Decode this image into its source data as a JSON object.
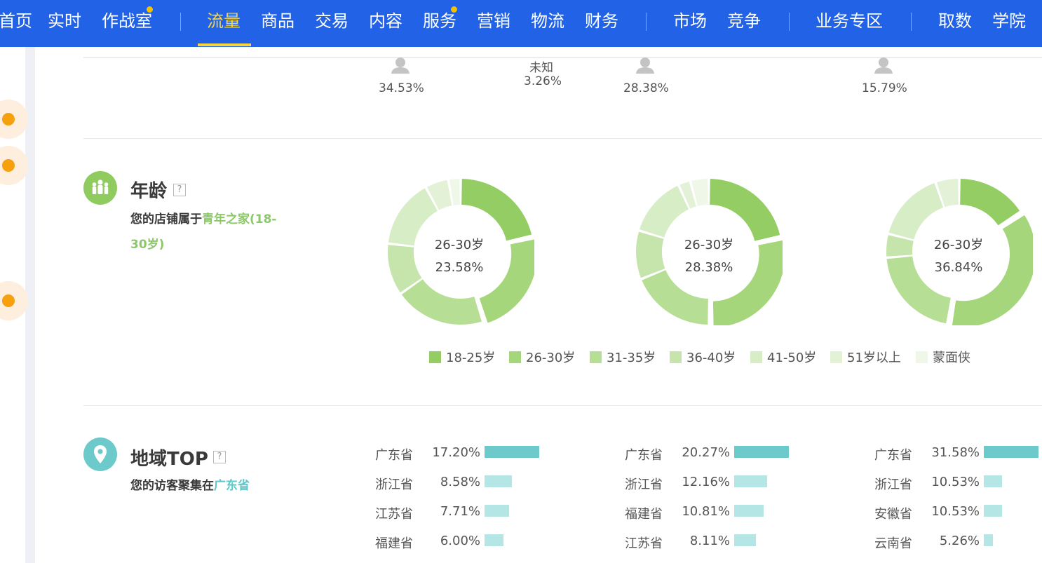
{
  "nav": {
    "items": [
      "首页",
      "实时",
      "作战室",
      "流量",
      "商品",
      "交易",
      "内容",
      "服务",
      "营销",
      "物流",
      "财务",
      "市场",
      "竞争",
      "业务专区",
      "取数",
      "学院"
    ],
    "active": "流量"
  },
  "gender": {
    "values": [
      "34.53%",
      "28.38%",
      "15.79%"
    ],
    "unknown_label": "未知",
    "unknown_value": "3.26%"
  },
  "age": {
    "title": "年龄",
    "help": "?",
    "desc_prefix": "您的店铺属于",
    "desc_highlight": "青年之家(18-30岁)",
    "desc_line1": "青年之家(18-",
    "desc_line2": "30岁)",
    "legend": [
      "18-25岁",
      "26-30岁",
      "31-35岁",
      "36-40岁",
      "41-50岁",
      "51岁以上",
      "蒙面侠"
    ],
    "colors": [
      "#93cd63",
      "#a6d67c",
      "#b6de95",
      "#c6e5ad",
      "#d6edc6",
      "#e3f2d7",
      "#eff7e8"
    ],
    "charts": [
      {
        "center_label": "26-30岁",
        "center_value": "23.58%",
        "values": [
          21.5,
          23.58,
          20.2,
          11.5,
          15.3,
          5.2,
          2.72
        ]
      },
      {
        "center_label": "26-30岁",
        "center_value": "28.38%",
        "values": [
          21.6,
          28.38,
          18.9,
          10.8,
          13.5,
          2.7,
          4.12
        ]
      },
      {
        "center_label": "26-30岁",
        "center_value": "36.84%",
        "values": [
          15.79,
          36.84,
          21.05,
          5.26,
          15.79,
          5.27,
          0
        ]
      }
    ]
  },
  "region": {
    "title": "地域TOP",
    "help": "?",
    "desc_prefix": "您的访客聚集在",
    "desc_highlight": "广东省",
    "top_color": "#6dcaca",
    "other_color": "#b4e6e6",
    "columns": [
      {
        "rows": [
          {
            "name": "广东省",
            "pct": "17.20%",
            "value": 17.2
          },
          {
            "name": "浙江省",
            "pct": "8.58%",
            "value": 8.58
          },
          {
            "name": "江苏省",
            "pct": "7.71%",
            "value": 7.71
          },
          {
            "name": "福建省",
            "pct": "6.00%",
            "value": 6.0
          }
        ]
      },
      {
        "rows": [
          {
            "name": "广东省",
            "pct": "20.27%",
            "value": 20.27
          },
          {
            "name": "浙江省",
            "pct": "12.16%",
            "value": 12.16
          },
          {
            "name": "福建省",
            "pct": "10.81%",
            "value": 10.81
          },
          {
            "name": "江苏省",
            "pct": "8.11%",
            "value": 8.11
          }
        ]
      },
      {
        "rows": [
          {
            "name": "广东省",
            "pct": "31.58%",
            "value": 31.58
          },
          {
            "name": "浙江省",
            "pct": "10.53%",
            "value": 10.53
          },
          {
            "name": "安徽省",
            "pct": "10.53%",
            "value": 10.53
          },
          {
            "name": "云南省",
            "pct": "5.26%",
            "value": 5.26
          }
        ]
      }
    ]
  }
}
